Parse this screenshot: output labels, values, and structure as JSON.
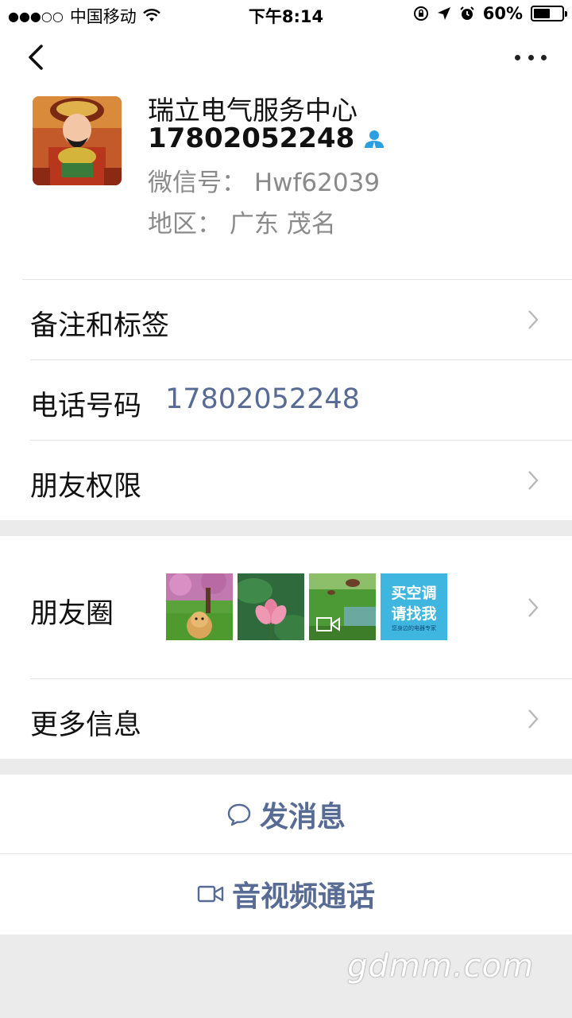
{
  "status_bar": {
    "signal": "●●●○○",
    "carrier": "中国移动",
    "time": "下午8:14",
    "battery": "60%",
    "battery_level": 0.6
  },
  "profile": {
    "name": "瑞立电气服务中心",
    "phone": "17802052248",
    "wechat_id": "微信号： Hwf62039",
    "region": "地区： 广东 茂名"
  },
  "rows": {
    "remarks": "备注和标签",
    "phone_label": "电话号码",
    "phone_value": "17802052248",
    "permissions": "朋友权限",
    "moments": "朋友圈",
    "more_info": "更多信息"
  },
  "moments_thumb_ad": {
    "line1": "买空调",
    "line2": "请找我",
    "line3": "您身边的电器专家"
  },
  "actions": {
    "message": "发消息",
    "video_call": "音视频通话"
  },
  "watermark": "gdmm.com",
  "colors": {
    "link": "#576b95",
    "gray_text": "#8a8a8a",
    "separator": "#ebebeb",
    "contact_icon": "#2b9fe0"
  }
}
